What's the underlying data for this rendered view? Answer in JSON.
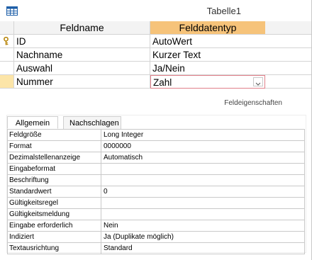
{
  "window": {
    "title": "Tabelle1"
  },
  "grid": {
    "col_field": "Feldname",
    "col_type": "Felddatentyp",
    "rows": [
      {
        "name": "ID",
        "type": "AutoWert"
      },
      {
        "name": "Nachname",
        "type": "Kurzer Text"
      },
      {
        "name": "Auswahl",
        "type": "Ja/Nein"
      },
      {
        "name": "Nummer",
        "type": "Zahl"
      }
    ]
  },
  "properties": {
    "section_label": "Feldeigenschaften",
    "tabs": [
      "Allgemein",
      "Nachschlagen"
    ],
    "rows": [
      {
        "name": "Feldgröße",
        "value": "Long Integer"
      },
      {
        "name": "Format",
        "value": "0000000"
      },
      {
        "name": "Dezimalstellenanzeige",
        "value": "Automatisch"
      },
      {
        "name": "Eingabeformat",
        "value": ""
      },
      {
        "name": "Beschriftung",
        "value": ""
      },
      {
        "name": "Standardwert",
        "value": "0"
      },
      {
        "name": "Gültigkeitsregel",
        "value": ""
      },
      {
        "name": "Gültigkeitsmeldung",
        "value": ""
      },
      {
        "name": "Eingabe erforderlich",
        "value": "Nein"
      },
      {
        "name": "Indiziert",
        "value": "Ja (Duplikate möglich)"
      },
      {
        "name": "Textausrichtung",
        "value": "Standard"
      }
    ]
  },
  "colors": {
    "header_highlight": "#f6c37a",
    "selected_row": "#fce5a8",
    "edit_border": "#e0808a"
  },
  "icons": {
    "table": "table-icon",
    "primary_key": "key-icon",
    "dropdown": "chevron-down-icon"
  }
}
